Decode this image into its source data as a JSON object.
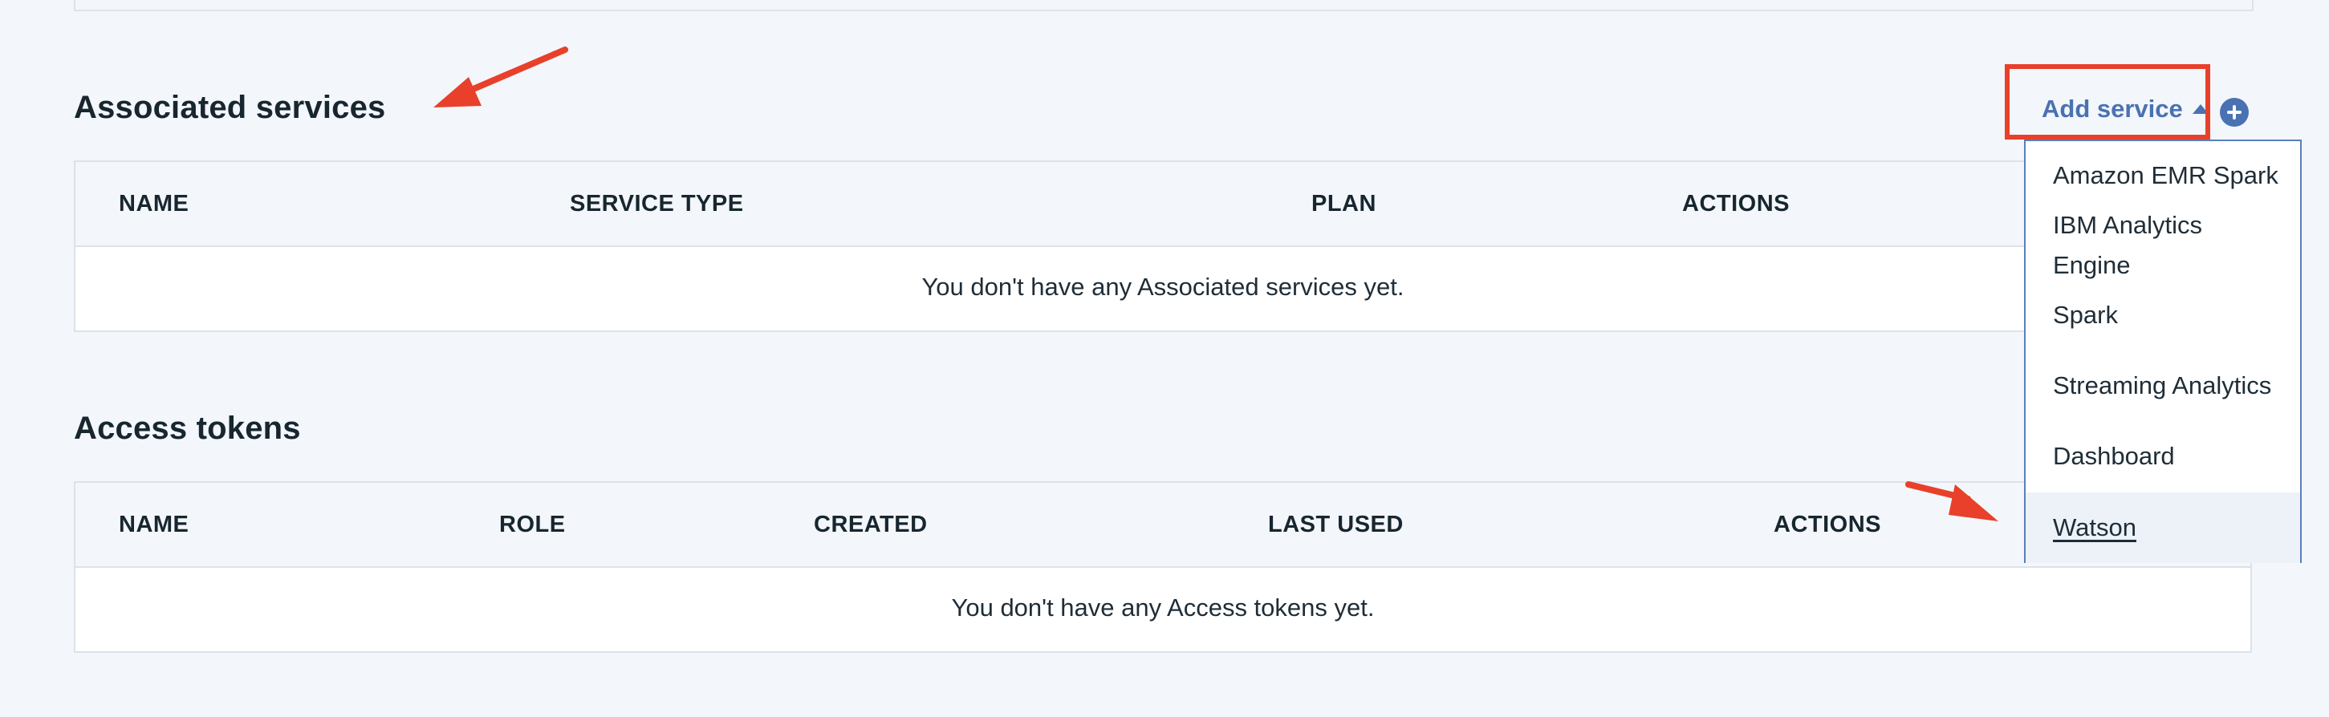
{
  "associated_services": {
    "title": "Associated services",
    "columns": [
      "NAME",
      "SERVICE TYPE",
      "PLAN",
      "ACTIONS"
    ],
    "empty_message": "You don't have any Associated services yet."
  },
  "access_tokens": {
    "title": "Access tokens",
    "columns": [
      "NAME",
      "ROLE",
      "CREATED",
      "LAST USED",
      "ACTIONS"
    ],
    "empty_message": "You don't have any Access tokens yet."
  },
  "add_service": {
    "label": "Add service",
    "icon": "plus-circle-icon",
    "menu_items": [
      "Amazon EMR Spark",
      "IBM Analytics Engine",
      "Spark",
      "Streaming Analytics",
      "Dashboard",
      "Watson"
    ],
    "selected": "Watson"
  },
  "colors": {
    "accent": "#4a72b2",
    "annotation": "#e8402a",
    "page_background": "#f3f6fb",
    "header_background": "#f3f6fb"
  }
}
